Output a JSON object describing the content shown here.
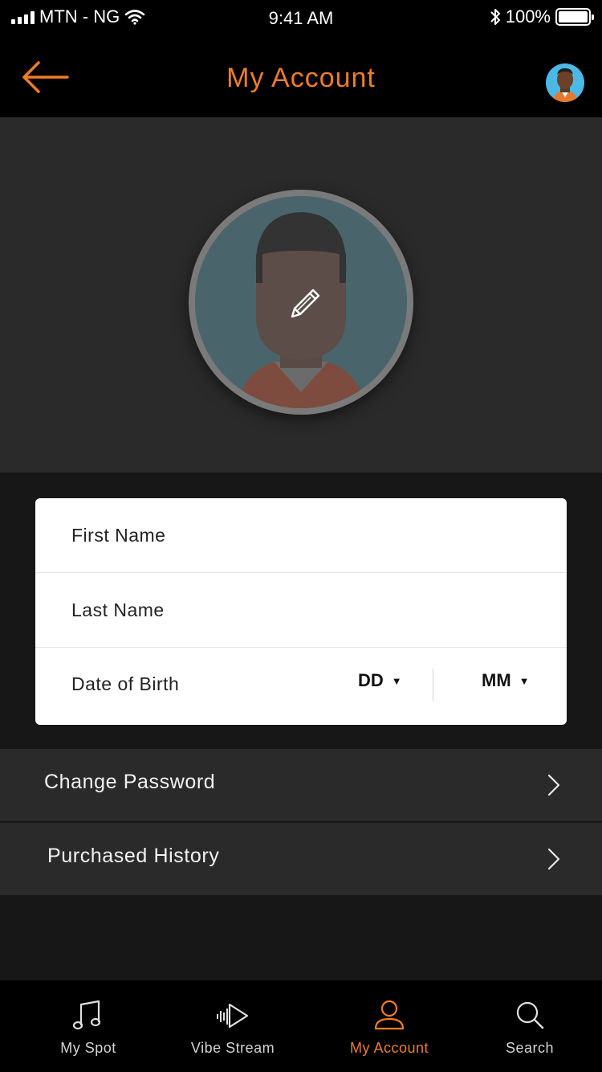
{
  "status_bar": {
    "carrier": "MTN - NG",
    "time": "9:41 AM",
    "battery": "100%",
    "icons": [
      "signal-icon",
      "wifi-icon",
      "bluetooth-icon",
      "battery-icon"
    ]
  },
  "header": {
    "title": "My Account",
    "back_icon": "arrow-left-icon",
    "avatar": "avatar"
  },
  "profile": {
    "edit_icon": "pencil-icon"
  },
  "form": {
    "first_name_placeholder": "First Name",
    "first_name_value": "",
    "last_name_placeholder": "Last Name",
    "last_name_value": "",
    "dob_label": "Date of Birth",
    "day_value": "DD",
    "month_value": "MM"
  },
  "menu": {
    "items": [
      {
        "label": "Change Password"
      },
      {
        "label": "Purchased History"
      }
    ]
  },
  "tabs": [
    {
      "label": "My Spot",
      "icon": "music-note-icon",
      "active": false
    },
    {
      "label": "Vibe Stream",
      "icon": "vibe-stream-icon",
      "active": false
    },
    {
      "label": "My Account",
      "icon": "user-icon",
      "active": true
    },
    {
      "label": "Search",
      "icon": "search-icon",
      "active": false
    }
  ],
  "colors": {
    "accent": "#ef7d22",
    "background": "#171717",
    "panel": "#2a2a2a",
    "bar": "#000000"
  }
}
